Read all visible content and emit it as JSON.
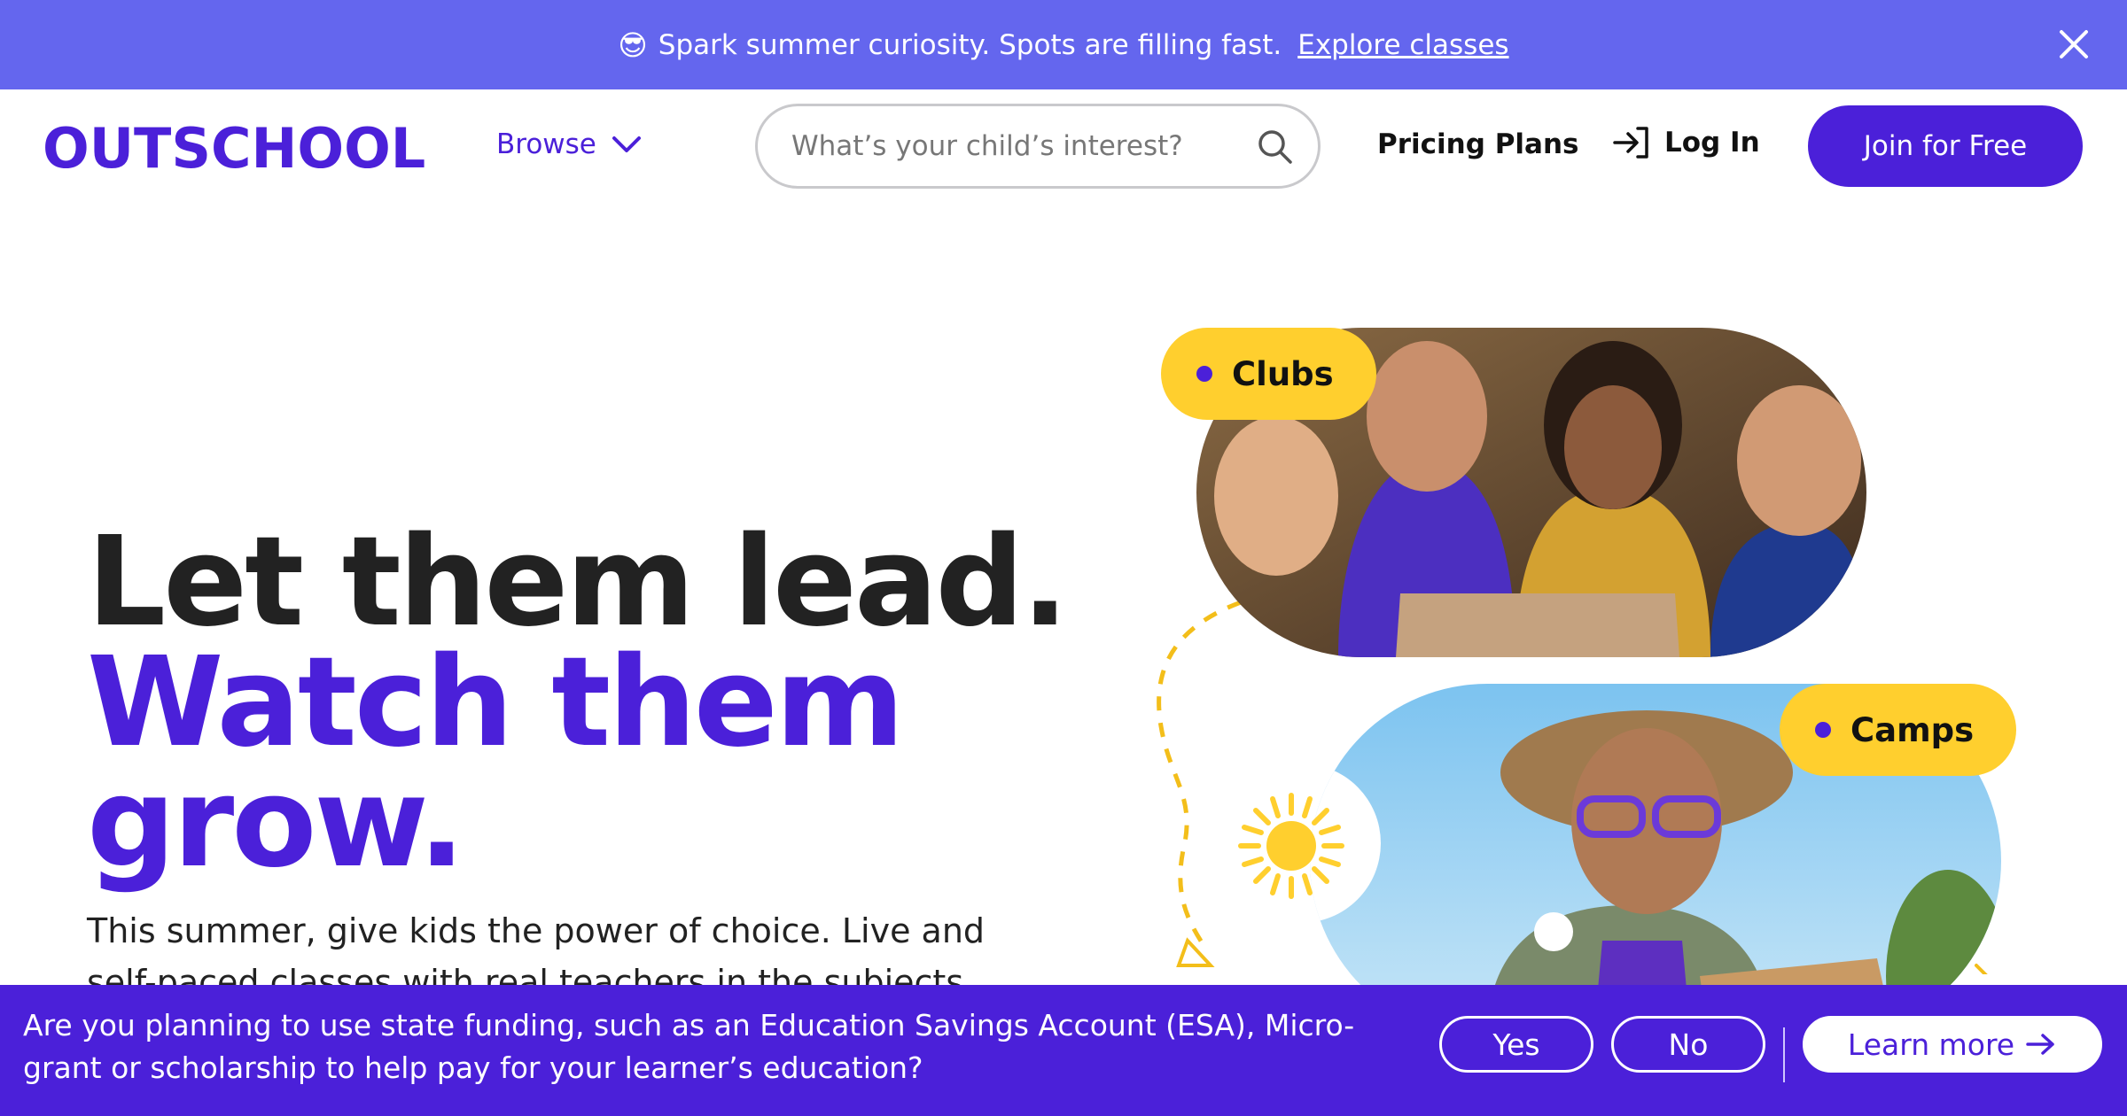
{
  "promo": {
    "emoji": "😎",
    "text": "Spark summer curiosity. Spots are filling fast.",
    "link": "Explore classes",
    "close_icon": "close-icon"
  },
  "header": {
    "logo": "OUTSCHOOL",
    "browse": "Browse",
    "search_placeholder": "What’s your child’s interest?",
    "pricing": "Pricing Plans",
    "login": "Log In",
    "join": "Join for Free"
  },
  "hero": {
    "title_line1": "Let them lead.",
    "title_line2": "Watch them",
    "title_line3": "grow.",
    "subtitle": "This summer, give kids the power of choice. Live and self-paced classes with real teachers in the subjects they’re"
  },
  "cards": {
    "clubs": "Clubs",
    "camps": "Camps"
  },
  "esa": {
    "question": "Are you planning to use state funding, such as an Education Savings Account (ESA), Micro-grant or scholarship to help pay for your learner’s education?",
    "yes": "Yes",
    "no": "No",
    "learn_more": "Learn more"
  },
  "colors": {
    "brand": "#4b20d9",
    "promo_bg": "#6466ee",
    "pill": "#ffcf2e"
  }
}
